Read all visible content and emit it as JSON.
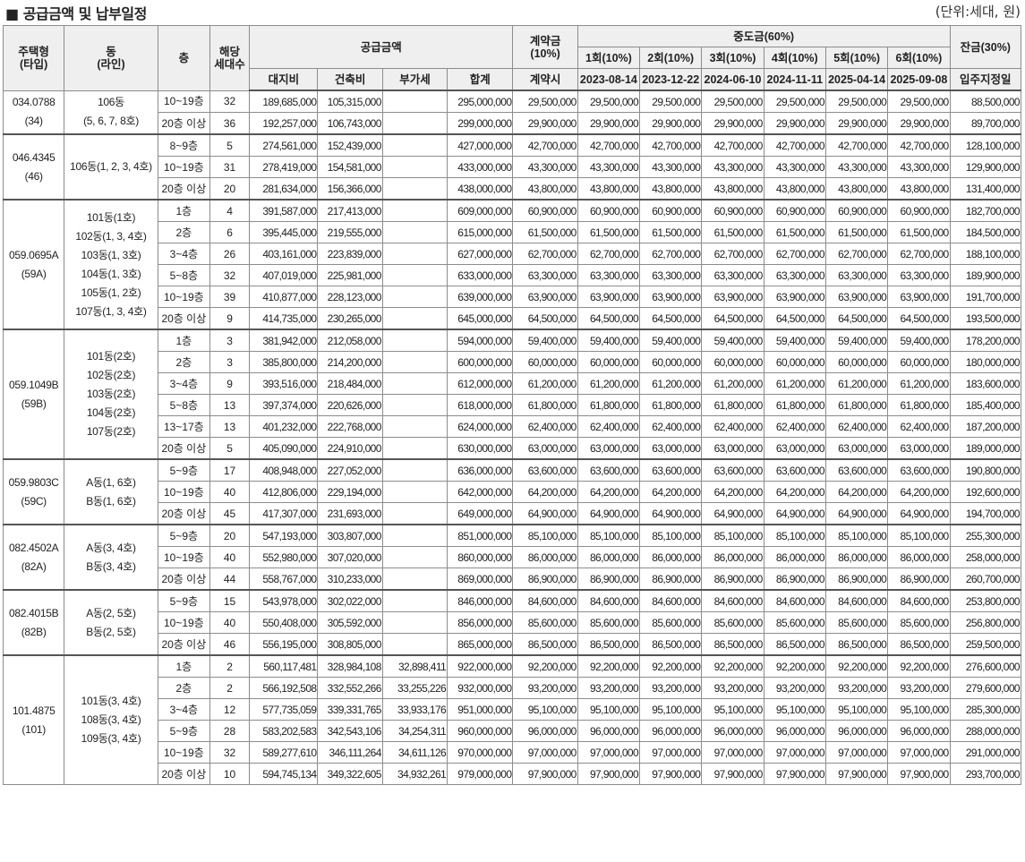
{
  "title": "■ 공급금액 및 납부일정",
  "unit": "(단위:세대, 원)",
  "headers": {
    "type": "주택형\n(타입)",
    "dong": "동\n(라인)",
    "floor": "층",
    "households": "해당\n세대수",
    "supply": "공급금액",
    "land": "대지비",
    "building": "건축비",
    "vat": "부가세",
    "total": "합계",
    "deposit": "계약금\n(10%)",
    "deposit_when": "계약시",
    "middle": "중도금(60%)",
    "balance": "잔금(30%)",
    "balance_when": "입주지정일",
    "installments": [
      {
        "label": "1회(10%)",
        "date": "2023-08-14"
      },
      {
        "label": "2회(10%)",
        "date": "2023-12-22"
      },
      {
        "label": "3회(10%)",
        "date": "2024-06-10"
      },
      {
        "label": "4회(10%)",
        "date": "2024-11-11"
      },
      {
        "label": "5회(10%)",
        "date": "2025-04-14"
      },
      {
        "label": "6회(10%)",
        "date": "2025-09-08"
      }
    ]
  },
  "groups": [
    {
      "type": "034.0788\n(34)",
      "dong": "106동\n(5, 6, 7, 8호)",
      "rows": [
        {
          "floor": "10~19층",
          "n": "32",
          "land": "189,685,000",
          "bld": "105,315,000",
          "vat": "",
          "total": "295,000,000",
          "dep": "29,500,000",
          "mid": "29,500,000",
          "bal": "88,500,000"
        },
        {
          "floor": "20층 이상",
          "n": "36",
          "land": "192,257,000",
          "bld": "106,743,000",
          "vat": "",
          "total": "299,000,000",
          "dep": "29,900,000",
          "mid": "29,900,000",
          "bal": "89,700,000"
        }
      ]
    },
    {
      "type": "046.4345\n(46)",
      "dong": "106동(1, 2, 3, 4호)",
      "rows": [
        {
          "floor": "8~9층",
          "n": "5",
          "land": "274,561,000",
          "bld": "152,439,000",
          "vat": "",
          "total": "427,000,000",
          "dep": "42,700,000",
          "mid": "42,700,000",
          "bal": "128,100,000"
        },
        {
          "floor": "10~19층",
          "n": "31",
          "land": "278,419,000",
          "bld": "154,581,000",
          "vat": "",
          "total": "433,000,000",
          "dep": "43,300,000",
          "mid": "43,300,000",
          "bal": "129,900,000"
        },
        {
          "floor": "20층 이상",
          "n": "20",
          "land": "281,634,000",
          "bld": "156,366,000",
          "vat": "",
          "total": "438,000,000",
          "dep": "43,800,000",
          "mid": "43,800,000",
          "bal": "131,400,000"
        }
      ]
    },
    {
      "type": "059.0695A\n(59A)",
      "dong": "101동(1호)\n102동(1, 3, 4호)\n103동(1, 3호)\n104동(1, 3호)\n105동(1, 2호)\n107동(1, 3, 4호)",
      "rows": [
        {
          "floor": "1층",
          "n": "4",
          "land": "391,587,000",
          "bld": "217,413,000",
          "vat": "",
          "total": "609,000,000",
          "dep": "60,900,000",
          "mid": "60,900,000",
          "bal": "182,700,000"
        },
        {
          "floor": "2층",
          "n": "6",
          "land": "395,445,000",
          "bld": "219,555,000",
          "vat": "",
          "total": "615,000,000",
          "dep": "61,500,000",
          "mid": "61,500,000",
          "bal": "184,500,000"
        },
        {
          "floor": "3~4층",
          "n": "26",
          "land": "403,161,000",
          "bld": "223,839,000",
          "vat": "",
          "total": "627,000,000",
          "dep": "62,700,000",
          "mid": "62,700,000",
          "bal": "188,100,000"
        },
        {
          "floor": "5~8층",
          "n": "32",
          "land": "407,019,000",
          "bld": "225,981,000",
          "vat": "",
          "total": "633,000,000",
          "dep": "63,300,000",
          "mid": "63,300,000",
          "bal": "189,900,000"
        },
        {
          "floor": "10~19층",
          "n": "39",
          "land": "410,877,000",
          "bld": "228,123,000",
          "vat": "",
          "total": "639,000,000",
          "dep": "63,900,000",
          "mid": "63,900,000",
          "bal": "191,700,000"
        },
        {
          "floor": "20층 이상",
          "n": "9",
          "land": "414,735,000",
          "bld": "230,265,000",
          "vat": "",
          "total": "645,000,000",
          "dep": "64,500,000",
          "mid": "64,500,000",
          "bal": "193,500,000"
        }
      ]
    },
    {
      "type": "059.1049B\n(59B)",
      "dong": "101동(2호)\n102동(2호)\n103동(2호)\n104동(2호)\n107동(2호)",
      "rows": [
        {
          "floor": "1층",
          "n": "3",
          "land": "381,942,000",
          "bld": "212,058,000",
          "vat": "",
          "total": "594,000,000",
          "dep": "59,400,000",
          "mid": "59,400,000",
          "bal": "178,200,000"
        },
        {
          "floor": "2층",
          "n": "3",
          "land": "385,800,000",
          "bld": "214,200,000",
          "vat": "",
          "total": "600,000,000",
          "dep": "60,000,000",
          "mid": "60,000,000",
          "bal": "180,000,000"
        },
        {
          "floor": "3~4층",
          "n": "9",
          "land": "393,516,000",
          "bld": "218,484,000",
          "vat": "",
          "total": "612,000,000",
          "dep": "61,200,000",
          "mid": "61,200,000",
          "bal": "183,600,000"
        },
        {
          "floor": "5~8층",
          "n": "13",
          "land": "397,374,000",
          "bld": "220,626,000",
          "vat": "",
          "total": "618,000,000",
          "dep": "61,800,000",
          "mid": "61,800,000",
          "bal": "185,400,000"
        },
        {
          "floor": "13~17층",
          "n": "13",
          "land": "401,232,000",
          "bld": "222,768,000",
          "vat": "",
          "total": "624,000,000",
          "dep": "62,400,000",
          "mid": "62,400,000",
          "bal": "187,200,000"
        },
        {
          "floor": "20층 이상",
          "n": "5",
          "land": "405,090,000",
          "bld": "224,910,000",
          "vat": "",
          "total": "630,000,000",
          "dep": "63,000,000",
          "mid": "63,000,000",
          "bal": "189,000,000"
        }
      ]
    },
    {
      "type": "059.9803C\n(59C)",
      "dong": "A동(1, 6호)\nB동(1, 6호)",
      "rows": [
        {
          "floor": "5~9층",
          "n": "17",
          "land": "408,948,000",
          "bld": "227,052,000",
          "vat": "",
          "total": "636,000,000",
          "dep": "63,600,000",
          "mid": "63,600,000",
          "bal": "190,800,000"
        },
        {
          "floor": "10~19층",
          "n": "40",
          "land": "412,806,000",
          "bld": "229,194,000",
          "vat": "",
          "total": "642,000,000",
          "dep": "64,200,000",
          "mid": "64,200,000",
          "bal": "192,600,000"
        },
        {
          "floor": "20층 이상",
          "n": "45",
          "land": "417,307,000",
          "bld": "231,693,000",
          "vat": "",
          "total": "649,000,000",
          "dep": "64,900,000",
          "mid": "64,900,000",
          "bal": "194,700,000"
        }
      ]
    },
    {
      "type": "082.4502A\n(82A)",
      "dong": "A동(3, 4호)\nB동(3, 4호)",
      "rows": [
        {
          "floor": "5~9층",
          "n": "20",
          "land": "547,193,000",
          "bld": "303,807,000",
          "vat": "",
          "total": "851,000,000",
          "dep": "85,100,000",
          "mid": "85,100,000",
          "bal": "255,300,000"
        },
        {
          "floor": "10~19층",
          "n": "40",
          "land": "552,980,000",
          "bld": "307,020,000",
          "vat": "",
          "total": "860,000,000",
          "dep": "86,000,000",
          "mid": "86,000,000",
          "bal": "258,000,000"
        },
        {
          "floor": "20층 이상",
          "n": "44",
          "land": "558,767,000",
          "bld": "310,233,000",
          "vat": "",
          "total": "869,000,000",
          "dep": "86,900,000",
          "mid": "86,900,000",
          "bal": "260,700,000"
        }
      ]
    },
    {
      "type": "082.4015B\n(82B)",
      "dong": "A동(2, 5호)\nB동(2, 5호)",
      "rows": [
        {
          "floor": "5~9층",
          "n": "15",
          "land": "543,978,000",
          "bld": "302,022,000",
          "vat": "",
          "total": "846,000,000",
          "dep": "84,600,000",
          "mid": "84,600,000",
          "bal": "253,800,000"
        },
        {
          "floor": "10~19층",
          "n": "40",
          "land": "550,408,000",
          "bld": "305,592,000",
          "vat": "",
          "total": "856,000,000",
          "dep": "85,600,000",
          "mid": "85,600,000",
          "bal": "256,800,000"
        },
        {
          "floor": "20층 이상",
          "n": "46",
          "land": "556,195,000",
          "bld": "308,805,000",
          "vat": "",
          "total": "865,000,000",
          "dep": "86,500,000",
          "mid": "86,500,000",
          "bal": "259,500,000"
        }
      ]
    },
    {
      "type": "101.4875\n(101)",
      "dong": "101동(3, 4호)\n108동(3, 4호)\n109동(3, 4호)",
      "rows": [
        {
          "floor": "1층",
          "n": "2",
          "land": "560,117,481",
          "bld": "328,984,108",
          "vat": "32,898,411",
          "total": "922,000,000",
          "dep": "92,200,000",
          "mid": "92,200,000",
          "bal": "276,600,000"
        },
        {
          "floor": "2층",
          "n": "2",
          "land": "566,192,508",
          "bld": "332,552,266",
          "vat": "33,255,226",
          "total": "932,000,000",
          "dep": "93,200,000",
          "mid": "93,200,000",
          "bal": "279,600,000"
        },
        {
          "floor": "3~4층",
          "n": "12",
          "land": "577,735,059",
          "bld": "339,331,765",
          "vat": "33,933,176",
          "total": "951,000,000",
          "dep": "95,100,000",
          "mid": "95,100,000",
          "bal": "285,300,000"
        },
        {
          "floor": "5~9층",
          "n": "28",
          "land": "583,202,583",
          "bld": "342,543,106",
          "vat": "34,254,311",
          "total": "960,000,000",
          "dep": "96,000,000",
          "mid": "96,000,000",
          "bal": "288,000,000"
        },
        {
          "floor": "10~19층",
          "n": "32",
          "land": "589,277,610",
          "bld": "346,111,264",
          "vat": "34,611,126",
          "total": "970,000,000",
          "dep": "97,000,000",
          "mid": "97,000,000",
          "bal": "291,000,000"
        },
        {
          "floor": "20층 이상",
          "n": "10",
          "land": "594,745,134",
          "bld": "349,322,605",
          "vat": "34,932,261",
          "total": "979,000,000",
          "dep": "97,900,000",
          "mid": "97,900,000",
          "bal": "293,700,000"
        }
      ]
    }
  ]
}
